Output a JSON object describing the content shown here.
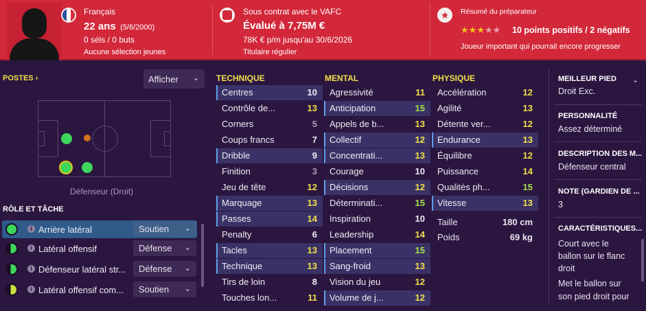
{
  "header": {
    "nationality": "Français",
    "age": "22 ans",
    "birth_date": "(5/6/2000)",
    "caps": "0 séls / 0 buts",
    "youth_caps": "Aucune sélection jeunes",
    "contract": "Sous contrat avec le VAFC",
    "value": "Évalué à 7,75M €",
    "wage": "78K € p/m jusqu'au 30/6/2026",
    "status": "Titulaire régulier",
    "coach_title": "Résumé du préparateur",
    "coach_stars": 3,
    "coach_stars_max": 5,
    "coach_summary": "10 points positifs / 2 négatifs",
    "coach_note": "Joueur important qui pourrait encore progresser",
    "colors": {
      "banner": "#d2283a",
      "flag_blue": "#2a4fa0",
      "flag_white": "#ffffff",
      "flag_red": "#d9303c"
    }
  },
  "positions": {
    "title": "POSTES",
    "title_arrow": "›",
    "show_label": "Afficher",
    "position_label": "Défenseur (Droit)"
  },
  "roles": {
    "title": "RÔLE ET TÂCHE",
    "items": [
      {
        "name": "Arrière latéral",
        "duty": "Soutien",
        "active": true,
        "indicator": "full-green"
      },
      {
        "name": "Latéral offensif",
        "duty": "Défense",
        "active": false,
        "indicator": "half-green"
      },
      {
        "name": "Défenseur latéral str...",
        "duty": "Défense",
        "active": false,
        "indicator": "half-green"
      },
      {
        "name": "Latéral offensif com...",
        "duty": "Soutien",
        "active": false,
        "indicator": "half-yellow"
      }
    ]
  },
  "attributes": {
    "technique": {
      "title": "TECHNIQUE",
      "rows": [
        {
          "name": "Centres",
          "value": "10",
          "hl": true
        },
        {
          "name": "Contrôle de...",
          "value": "13",
          "hl": false
        },
        {
          "name": "Corners",
          "value": "5",
          "hl": false
        },
        {
          "name": "Coups francs",
          "value": "7",
          "hl": false
        },
        {
          "name": "Dribble",
          "value": "9",
          "hl": true
        },
        {
          "name": "Finition",
          "value": "3",
          "hl": false
        },
        {
          "name": "Jeu de tête",
          "value": "12",
          "hl": false
        },
        {
          "name": "Marquage",
          "value": "13",
          "hl": true
        },
        {
          "name": "Passes",
          "value": "14",
          "hl": true
        },
        {
          "name": "Penalty",
          "value": "6",
          "hl": false
        },
        {
          "name": "Tacles",
          "value": "13",
          "hl": true
        },
        {
          "name": "Technique",
          "value": "13",
          "hl": true
        },
        {
          "name": "Tirs de loin",
          "value": "8",
          "hl": false
        },
        {
          "name": "Touches lon...",
          "value": "11",
          "hl": false
        }
      ]
    },
    "mental": {
      "title": "MENTAL",
      "rows": [
        {
          "name": "Agressivité",
          "value": "11",
          "hl": false
        },
        {
          "name": "Anticipation",
          "value": "15",
          "hl": true
        },
        {
          "name": "Appels de b...",
          "value": "13",
          "hl": false
        },
        {
          "name": "Collectif",
          "value": "12",
          "hl": true
        },
        {
          "name": "Concentrati...",
          "value": "13",
          "hl": true
        },
        {
          "name": "Courage",
          "value": "10",
          "hl": false
        },
        {
          "name": "Décisions",
          "value": "12",
          "hl": true
        },
        {
          "name": "Déterminati...",
          "value": "15",
          "hl": false
        },
        {
          "name": "Inspiration",
          "value": "10",
          "hl": false
        },
        {
          "name": "Leadership",
          "value": "14",
          "hl": false
        },
        {
          "name": "Placement",
          "value": "15",
          "hl": true
        },
        {
          "name": "Sang-froid",
          "value": "13",
          "hl": true
        },
        {
          "name": "Vision du jeu",
          "value": "12",
          "hl": false
        },
        {
          "name": "Volume de j...",
          "value": "12",
          "hl": true
        }
      ]
    },
    "physique": {
      "title": "PHYSIQUE",
      "rows": [
        {
          "name": "Accélération",
          "value": "12",
          "hl": false
        },
        {
          "name": "Agilité",
          "value": "13",
          "hl": false
        },
        {
          "name": "Détente ver...",
          "value": "12",
          "hl": false
        },
        {
          "name": "Endurance",
          "value": "13",
          "hl": true
        },
        {
          "name": "Équilibre",
          "value": "12",
          "hl": false
        },
        {
          "name": "Puissance",
          "value": "14",
          "hl": false
        },
        {
          "name": "Qualités ph...",
          "value": "15",
          "hl": false
        },
        {
          "name": "Vitesse",
          "value": "13",
          "hl": true
        }
      ],
      "height_label": "Taille",
      "height_value": "180 cm",
      "weight_label": "Poids",
      "weight_value": "69 kg"
    }
  },
  "side": {
    "foot_title": "MEILLEUR PIED",
    "foot_value": "Droit Exc.",
    "personality_title": "PERSONNALITÉ",
    "personality_value": "Assez déterminé",
    "description_title": "DESCRIPTION DES M...",
    "description_value": "Défenseur central",
    "gk_title": "NOTE (GARDIEN DE ...",
    "gk_value": "3",
    "traits_title": "CARACTÉRISTIQUES...",
    "traits": [
      "Court avec le",
      "ballon sur le flanc",
      "droit",
      "Met le ballon sur",
      "son pied droit pour"
    ]
  }
}
